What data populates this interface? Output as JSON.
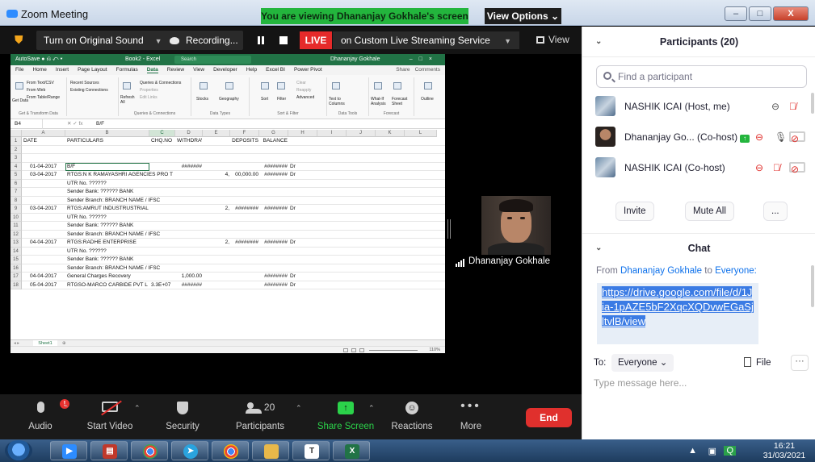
{
  "window": {
    "title": "Zoom Meeting",
    "viewing_banner": "You are viewing Dhananjay Gokhale's screen",
    "view_options": "View Options",
    "min_btn": "–",
    "max_btn": "□",
    "close_btn": "X"
  },
  "topbar": {
    "original_sound": "Turn on Original Sound",
    "recording": "Recording...",
    "live_badge": "LIVE",
    "stream_label": "on Custom Live Streaming Service",
    "view_label": "View"
  },
  "excel": {
    "search": "Search",
    "book": "Book2 - Excel",
    "user": "Dhananjay Gokhale",
    "ribbon_tabs": [
      "File",
      "Home",
      "Insert",
      "Page Layout",
      "Formulas",
      "Data",
      "Review",
      "View",
      "Developer",
      "Help",
      "Excel BI",
      "Power Pivot"
    ],
    "active_tab": "Data",
    "share": "Share",
    "comments": "Comments",
    "ribbon_groups": [
      "Get & Transform Data",
      "Queries & Connections",
      "Data Types",
      "Sort & Filter",
      "Data Tools",
      "Forecast",
      ""
    ],
    "ribbon_items": {
      "from_text": "From Text/CSV",
      "from_web": "From Web",
      "from_table": "From Table/Range",
      "recent_sources": "Recent Sources",
      "existing_conn": "Existing Connections",
      "refresh": "Refresh All",
      "queries": "Queries & Connections",
      "properties": "Properties",
      "edit_links": "Edit Links",
      "stocks": "Stocks",
      "geography": "Geography",
      "sort": "Sort",
      "filter": "Filter",
      "clear": "Clear",
      "reapply": "Reapply",
      "advanced": "Advanced",
      "text_to_columns": "Text to Columns",
      "what_if": "What-If Analysis",
      "forecast_sheet": "Forecast Sheet",
      "outline": "Outline",
      "get_data": "Get Data"
    },
    "name_box": "B4",
    "formula_value": "B/F",
    "columns": [
      "A",
      "B",
      "C",
      "D",
      "E",
      "F",
      "G",
      "H",
      "I",
      "J",
      "K",
      "L"
    ],
    "selected_column": "C",
    "rows": [
      {
        "n": "1",
        "A": "DATE",
        "B": "PARTICULARS",
        "C": "CHQ.NO",
        "D": "WITHDRAWALS",
        "E": "",
        "F": "DEPOSITS",
        "G": "BALANCE",
        "H": ""
      },
      {
        "n": "2",
        "A": "",
        "B": "",
        "C": "",
        "D": "",
        "E": "",
        "F": "",
        "G": "",
        "H": ""
      },
      {
        "n": "3",
        "A": "",
        "B": "",
        "C": "",
        "D": "",
        "E": "",
        "F": "",
        "G": "",
        "H": ""
      },
      {
        "n": "4",
        "A": "01-04-2017",
        "B": "B/F",
        "C": "",
        "D": "#######",
        "E": "",
        "F": "",
        "G": "########",
        "H": "Dr"
      },
      {
        "n": "5",
        "A": "03-04-2017",
        "B": "RTGS:N K RAMAYASHRI AGENCIES  PRO T",
        "C": "",
        "D": "",
        "E": "4,",
        "F": "00,000.00",
        "G": "########",
        "H": "Dr"
      },
      {
        "n": "6",
        "A": "",
        "B": "UTR No. ??????",
        "C": "",
        "D": "",
        "E": "",
        "F": "",
        "G": "",
        "H": ""
      },
      {
        "n": "7",
        "A": "",
        "B": "Sender Bank: ?????? BANK",
        "C": "",
        "D": "",
        "E": "",
        "F": "",
        "G": "",
        "H": ""
      },
      {
        "n": "8",
        "A": "",
        "B": "Sender Branch: BRANCH NAME / IFSC",
        "C": "",
        "D": "",
        "E": "",
        "F": "",
        "G": "",
        "H": ""
      },
      {
        "n": "9",
        "A": "03-04-2017",
        "B": "RTGS:AMRUT INDUSTRUSTRIAL",
        "C": "",
        "D": "",
        "E": "2,",
        "F": "########",
        "G": "########",
        "H": "Dr"
      },
      {
        "n": "10",
        "A": "",
        "B": "UTR No. ??????",
        "C": "",
        "D": "",
        "E": "",
        "F": "",
        "G": "",
        "H": ""
      },
      {
        "n": "11",
        "A": "",
        "B": "Sender Bank: ?????? BANK",
        "C": "",
        "D": "",
        "E": "",
        "F": "",
        "G": "",
        "H": ""
      },
      {
        "n": "12",
        "A": "",
        "B": "Sender Branch: BRANCH NAME / IFSC",
        "C": "",
        "D": "",
        "E": "",
        "F": "",
        "G": "",
        "H": ""
      },
      {
        "n": "13",
        "A": "04-04-2017",
        "B": "RTGS:RADHE ENTERPRISE",
        "C": "",
        "D": "",
        "E": "2,",
        "F": "########",
        "G": "########",
        "H": "Dr"
      },
      {
        "n": "14",
        "A": "",
        "B": "UTR No. ??????",
        "C": "",
        "D": "",
        "E": "",
        "F": "",
        "G": "",
        "H": ""
      },
      {
        "n": "15",
        "A": "",
        "B": "Sender Bank: ?????? BANK",
        "C": "",
        "D": "",
        "E": "",
        "F": "",
        "G": "",
        "H": ""
      },
      {
        "n": "16",
        "A": "",
        "B": "Sender Branch: BRANCH NAME / IFSC",
        "C": "",
        "D": "",
        "E": "",
        "F": "",
        "G": "",
        "H": ""
      },
      {
        "n": "17",
        "A": "04-04-2017",
        "B": "General Charges Recovery",
        "C": "",
        "D": "1,000.00",
        "E": "",
        "F": "",
        "G": "########",
        "H": "Dr"
      },
      {
        "n": "18",
        "A": "05-04-2017",
        "B": "RTGSO-MARCO CARBIDE PVT L",
        "C": "3.3E+07",
        "D": "#######",
        "E": "",
        "F": "",
        "G": "########",
        "H": "Dr"
      }
    ],
    "sheet_tab": "Sheet1",
    "zoom": "110%"
  },
  "video": {
    "name": "Dhananjay Gokhale"
  },
  "controls": {
    "audio": "Audio",
    "audio_badge": "!",
    "start_video": "Start Video",
    "security": "Security",
    "participants": "Participants",
    "participants_count": "20",
    "share_screen": "Share Screen",
    "reactions": "Reactions",
    "more": "More",
    "end": "End"
  },
  "panel": {
    "participants_title": "Participants (20)",
    "search_placeholder": "Find a participant",
    "participants": [
      {
        "name": "NASHIK ICAI (Host, me)",
        "sharing": false
      },
      {
        "name": "Dhananjay Go... (Co-host)",
        "sharing": true
      },
      {
        "name": "NASHIK ICAI (Co-host)",
        "sharing": false
      }
    ],
    "invite": "Invite",
    "mute_all": "Mute All",
    "more": "...",
    "chat_title": "Chat",
    "chat_from_prefix": "From",
    "chat_sender": "Dhananjay Gokhale",
    "chat_to_word": "to",
    "chat_recipient": "Everyone:",
    "chat_message": "https://drive.google.com/file/d/1Jia-1pAZE5bF2XqcXQDvwEGaSjltvlB/view",
    "to_label": "To:",
    "to_value": "Everyone",
    "file_label": "File",
    "more_dots": "···",
    "input_placeholder": "Type message here..."
  },
  "taskbar": {
    "time": "16:21",
    "date": "31/03/2021"
  }
}
